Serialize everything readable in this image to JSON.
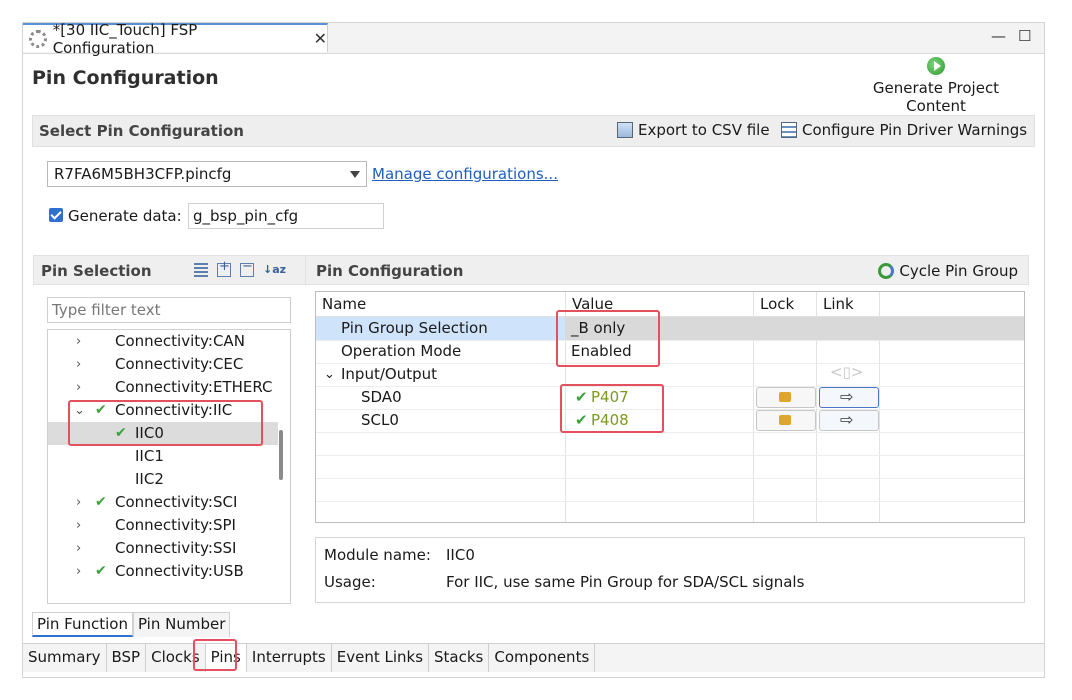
{
  "editor_tab": {
    "title": "*[30 IIC_Touch] FSP Configuration",
    "close": "✕"
  },
  "window_controls": {
    "minimize": "—",
    "maximize": "☐"
  },
  "page": {
    "title": "Pin Configuration",
    "generate_label": "Generate Project Content"
  },
  "select_section": {
    "title": "Select Pin Configuration",
    "export_label": "Export to CSV file",
    "warnings_label": "Configure Pin Driver Warnings",
    "config_file": "R7FA6M5BH3CFP.pincfg",
    "manage_link": "Manage configurations...",
    "generate_data_label": "Generate data:",
    "generate_data_value": "g_bsp_pin_cfg",
    "generate_data_checked": true
  },
  "pin_selection": {
    "title": "Pin Selection",
    "filter_placeholder": "Type filter text",
    "tree": [
      {
        "label": "Connectivity:CAN",
        "chevron": "›",
        "check": ""
      },
      {
        "label": "Connectivity:CEC",
        "chevron": "›",
        "check": ""
      },
      {
        "label": "Connectivity:ETHERC",
        "chevron": "›",
        "check": ""
      },
      {
        "label": "Connectivity:IIC",
        "chevron": "⌄",
        "check": "✔"
      },
      {
        "label": "IIC0",
        "chevron": "",
        "check": "✔"
      },
      {
        "label": "IIC1",
        "chevron": "",
        "check": ""
      },
      {
        "label": "IIC2",
        "chevron": "",
        "check": ""
      },
      {
        "label": "Connectivity:SCI",
        "chevron": "›",
        "check": "✔"
      },
      {
        "label": "Connectivity:SPI",
        "chevron": "›",
        "check": ""
      },
      {
        "label": "Connectivity:SSI",
        "chevron": "›",
        "check": ""
      },
      {
        "label": "Connectivity:USB",
        "chevron": "›",
        "check": "✔"
      }
    ]
  },
  "pin_config": {
    "title": "Pin Configuration",
    "cycle_label": "Cycle Pin Group",
    "columns": {
      "name": "Name",
      "value": "Value",
      "lock": "Lock",
      "link": "Link"
    },
    "rows": [
      {
        "name": "Pin Group Selection",
        "value": "_B only"
      },
      {
        "name": "Operation Mode",
        "value": "Enabled"
      },
      {
        "name": "Input/Output",
        "value": "",
        "chevron": "⌄"
      },
      {
        "name": "SDA0",
        "value": "P407",
        "check": "✔"
      },
      {
        "name": "SCL0",
        "value": "P408",
        "check": "✔"
      }
    ],
    "module_label": "Module name:",
    "module_value": "IIC0",
    "usage_label": "Usage:",
    "usage_value": "For IIC, use same Pin Group for SDA/SCL signals"
  },
  "function_tabs": [
    "Pin Function",
    "Pin Number"
  ],
  "bottom_tabs": [
    "Summary",
    "BSP",
    "Clocks",
    "Pins",
    "Interrupts",
    "Event Links",
    "Stacks",
    "Components"
  ]
}
